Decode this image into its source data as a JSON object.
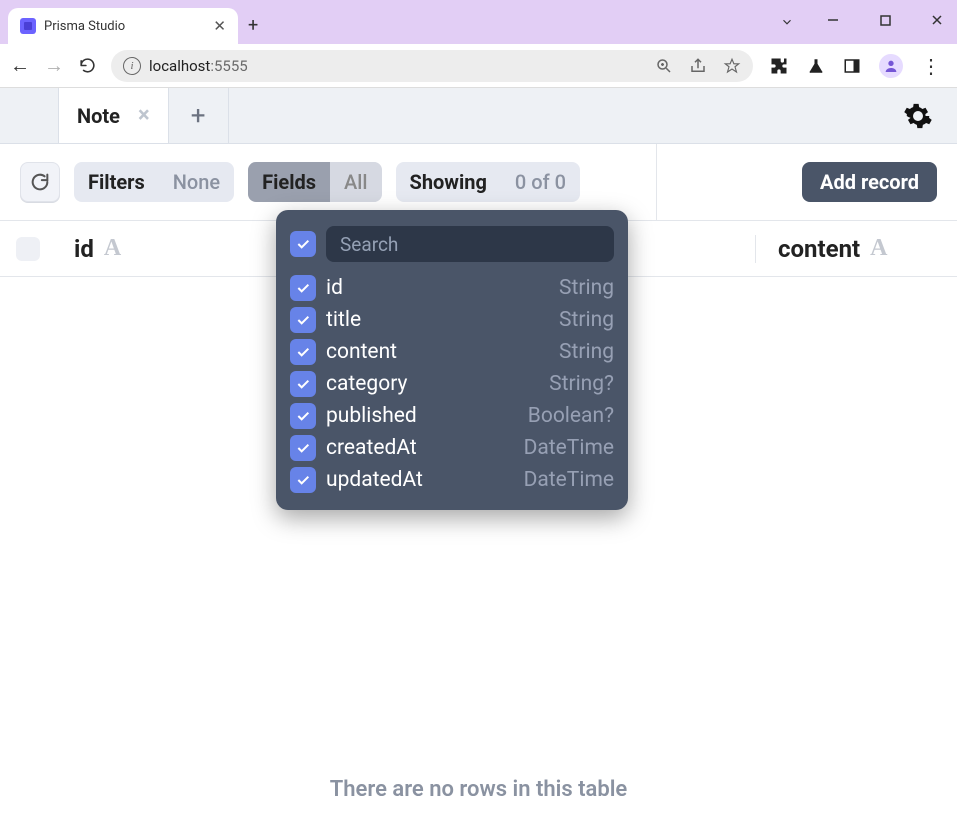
{
  "browser": {
    "tab_title": "Prisma Studio",
    "url_host": "localhost",
    "url_port": ":5555"
  },
  "model_tabs": {
    "active": "Note"
  },
  "toolbar": {
    "filters_label": "Filters",
    "filters_value": "None",
    "fields_label": "Fields",
    "fields_value": "All",
    "showing_label": "Showing",
    "showing_value": "0 of 0",
    "add_record_label": "Add record"
  },
  "columns": {
    "c0": {
      "name": "id",
      "badge": "A"
    },
    "c1": {
      "name": "content",
      "badge": "A"
    }
  },
  "fields_panel": {
    "search_placeholder": "Search",
    "items": [
      {
        "name": "id",
        "type": "String"
      },
      {
        "name": "title",
        "type": "String"
      },
      {
        "name": "content",
        "type": "String"
      },
      {
        "name": "category",
        "type": "String?"
      },
      {
        "name": "published",
        "type": "Boolean?"
      },
      {
        "name": "createdAt",
        "type": "DateTime"
      },
      {
        "name": "updatedAt",
        "type": "DateTime"
      }
    ]
  },
  "empty_message": "There are no rows in this table"
}
